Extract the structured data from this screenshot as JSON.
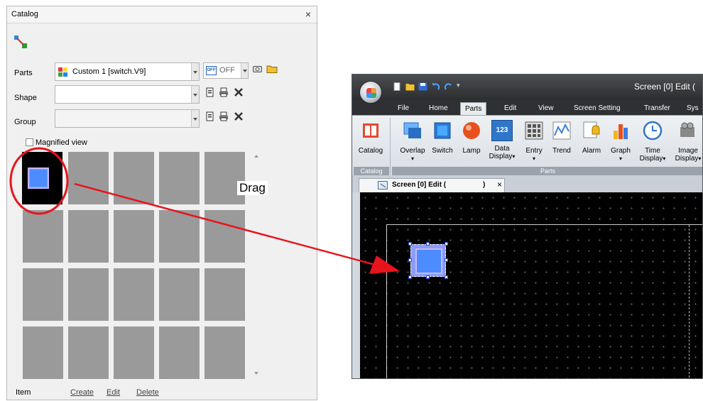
{
  "catalog": {
    "title": "Catalog",
    "close_glyph": "×",
    "parts_label": "Parts",
    "parts_value": "Custom 1 [switch.V9]",
    "off_badge": "OFF",
    "off_value": "OFF",
    "shape_label": "Shape",
    "shape_value": "",
    "group_label": "Group",
    "group_value": "",
    "magnified_label": "Magnified view",
    "item_label": "Item",
    "create_label": "Create",
    "edit_label": "Edit",
    "delete_label": "Delete",
    "drag_label": "Drag",
    "icons": [
      "catalog-tool-icon",
      "parts-color-icon",
      "camera-icon",
      "folder-icon",
      "save-icon",
      "print-icon",
      "delete-x-icon"
    ]
  },
  "editor": {
    "window_title": "Screen [0] Edit (",
    "tabs": [
      "File",
      "Home",
      "Parts",
      "Edit",
      "View",
      "Screen Setting",
      "Transfer",
      "Sys"
    ],
    "active_tab": "Parts",
    "ribbon_buttons": {
      "catalog": "Catalog",
      "overlap": "Overlap",
      "switch": "Switch",
      "lamp": "Lamp",
      "data_display_1": "Data",
      "data_display_2": "Display",
      "entry": "Entry",
      "trend": "Trend",
      "alarm": "Alarm",
      "graph": "Graph",
      "time_display_1": "Time",
      "time_display_2": "Display",
      "image_display_1": "Image",
      "image_display_2": "Display"
    },
    "data_icon_text": "123",
    "group_catalog": "Catalog",
    "group_parts": "Parts",
    "doc_tab_label": "Screen [0] Edit (",
    "doc_tab_paren": ")",
    "doc_tab_close": "×",
    "dropdown_glyph": "▾"
  },
  "colors": {
    "switch_blue": "#4d8cff",
    "arrow_red": "#e8141c",
    "ribbon_dark": "#2f3033"
  }
}
